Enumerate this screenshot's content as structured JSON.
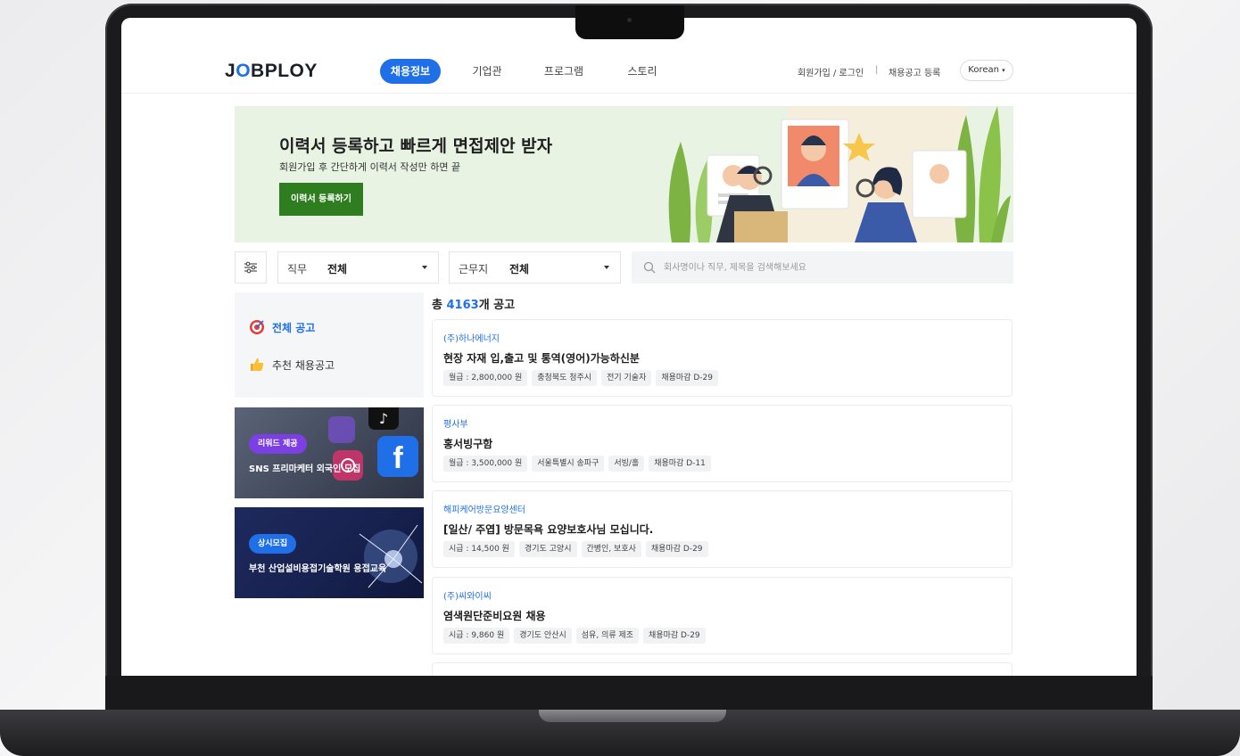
{
  "header": {
    "logo": {
      "prefix": "J",
      "o": "O",
      "rest": "BPLOY"
    },
    "tabs": [
      "채용정보",
      "기업관",
      "프로그램",
      "스토리"
    ],
    "signup_login": "회원가입 / 로그인",
    "separator": "|",
    "post_job": "채용공고 등록",
    "language": "Korean"
  },
  "banner": {
    "title": "이력서 등록하고 빠르게 면접제안 받자",
    "subtitle": "회원가입 후 간단하게 이력서 작성만 하면 끝",
    "button": "이력서 등록하기"
  },
  "filters": {
    "job_label": "직무",
    "job_value": "전체",
    "location_label": "근무지",
    "location_value": "전체",
    "search_placeholder": "회사명이나 직무, 제목을 검색해보세요"
  },
  "sidebar": {
    "items": [
      {
        "label": "전체 공고",
        "icon": "target-icon",
        "active": true
      },
      {
        "label": "추천 채용공고",
        "icon": "thumbs-up-icon",
        "active": false
      }
    ]
  },
  "ads": [
    {
      "badge": "리워드 제공",
      "title": "SNS 프리마케터 외국인 모집"
    },
    {
      "badge": "상시모집",
      "title": "부천 산업설비용접기술학원 용접교육"
    }
  ],
  "listing": {
    "total_prefix": "총 ",
    "total_count": "4163",
    "total_suffix": "개 공고",
    "jobs": [
      {
        "company": "(주)하나에너지",
        "title": "현장 자재 입,출고 및 통역(영어)가능하신분",
        "tags": [
          "월급 : 2,800,000 원",
          "충청북도 청주시",
          "전기 기술자",
          "채용마감 D-29"
        ]
      },
      {
        "company": "평사부",
        "title": "홍서빙구함",
        "tags": [
          "월급 : 3,500,000 원",
          "서울특별시 송파구",
          "서빙/홀",
          "채용마감 D-11"
        ]
      },
      {
        "company": "해피케어방문요양센터",
        "title": "[일산/ 주엽] 방문목욕 요양보호사님 모십니다.",
        "tags": [
          "시급 : 14,500 원",
          "경기도 고양시",
          "간병인, 보호사",
          "채용마감 D-29"
        ]
      },
      {
        "company": "(주)씨와이씨",
        "title": "염색원단준비요원 채용",
        "tags": [
          "시급 : 9,860 원",
          "경기도 안산시",
          "섬유, 의류 제조",
          "채용마감 D-29"
        ]
      }
    ]
  },
  "colors": {
    "primary": "#1f6fe8",
    "banner_bg": "#e9f3e4",
    "banner_button": "#2e7d1e"
  }
}
